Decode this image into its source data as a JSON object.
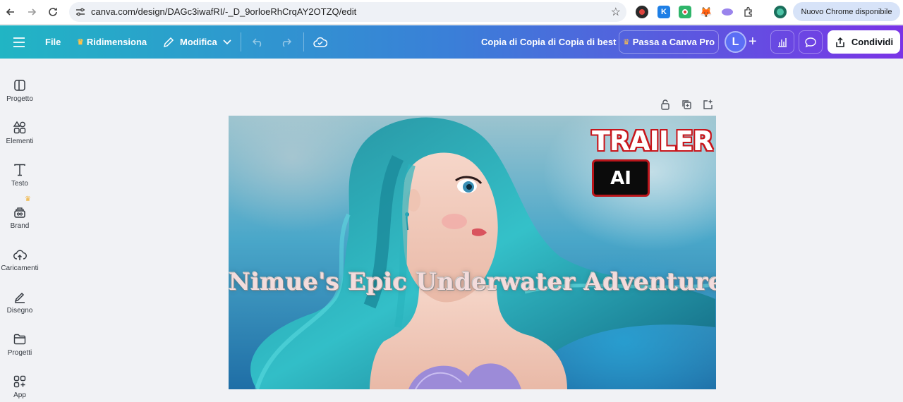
{
  "browser": {
    "url": "canva.com/design/DAGc3iwafRI/-_D_9orloeRhCrqAY2OTZQ/edit",
    "update_pill": "Nuovo Chrome disponibile",
    "icons": [
      "back-icon",
      "forward-icon",
      "reload-icon",
      "tune-icon",
      "star-icon",
      "extensions-icon",
      "profile-icon"
    ]
  },
  "header": {
    "menu_icon": "hamburger-icon",
    "file_label": "File",
    "resize_label": "Ridimensiona",
    "edit_label": "Modifica",
    "doc_title": "Copia di Copia di Copia di best",
    "upgrade_label": "Passa a Canva Pro",
    "avatar_initial": "L",
    "share_label": "Condividi",
    "accent_colors": [
      "#21b5c4",
      "#3a7fd8",
      "#7a34e6"
    ]
  },
  "sidebar": {
    "items": [
      {
        "label": "Progetto",
        "icon": "layout-icon"
      },
      {
        "label": "Elementi",
        "icon": "shapes-icon"
      },
      {
        "label": "Testo",
        "icon": "text-icon"
      },
      {
        "label": "Brand",
        "icon": "brand-icon"
      },
      {
        "label": "Caricamenti",
        "icon": "upload-cloud-icon"
      },
      {
        "label": "Disegno",
        "icon": "draw-icon"
      },
      {
        "label": "Progetti",
        "icon": "folder-icon"
      },
      {
        "label": "App",
        "icon": "apps-icon"
      }
    ]
  },
  "design": {
    "trailer_text": "TRAILER",
    "ai_text": "AI",
    "title_text": "Nimue's Epic Underwater Adventure"
  }
}
